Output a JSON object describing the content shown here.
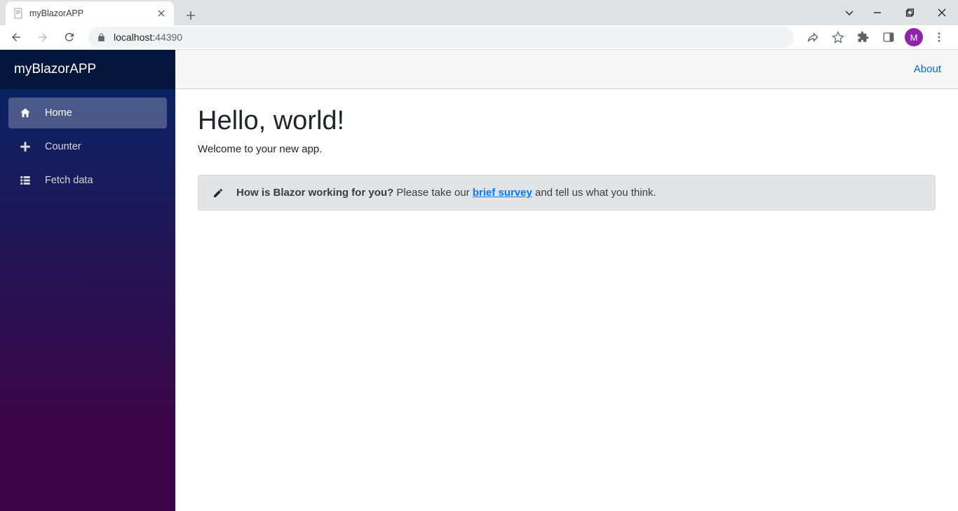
{
  "browser": {
    "tab_title": "myBlazorAPP",
    "url_host": "localhost:",
    "url_port": "44390",
    "avatar_letter": "M"
  },
  "sidebar": {
    "brand": "myBlazorAPP",
    "items": [
      {
        "label": "Home"
      },
      {
        "label": "Counter"
      },
      {
        "label": "Fetch data"
      }
    ]
  },
  "header": {
    "about": "About"
  },
  "main": {
    "heading": "Hello, world!",
    "welcome": "Welcome to your new app.",
    "survey_strong": "How is Blazor working for you?",
    "survey_before": " Please take our ",
    "survey_link": "brief survey",
    "survey_after": " and tell us what you think."
  }
}
